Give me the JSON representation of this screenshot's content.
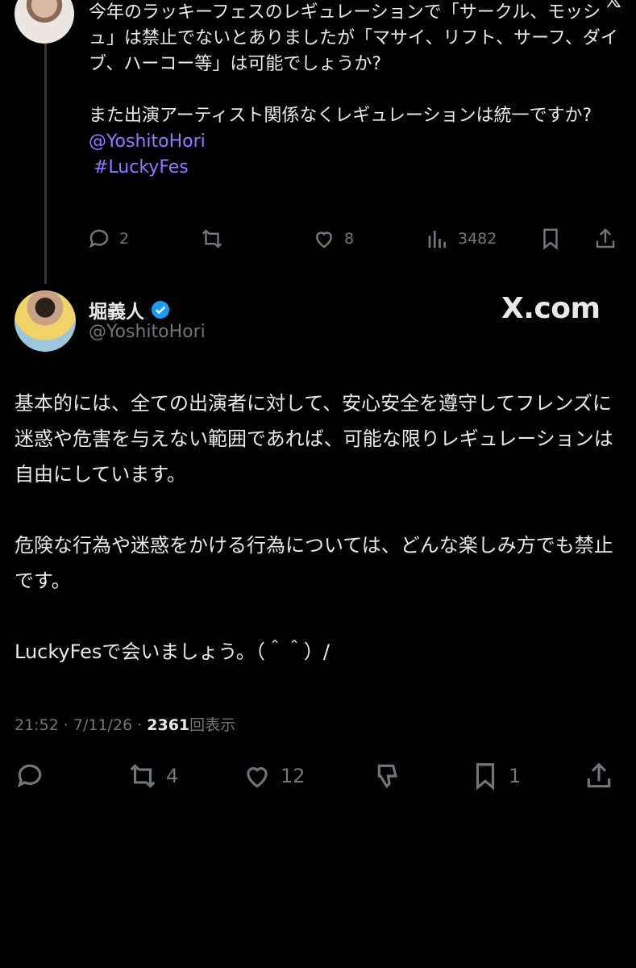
{
  "reply": {
    "paragraph1": "今年のラッキーフェスのレギュレーションで「サークル、モッシュ」は禁止でないとありましたが「マサイ、リフト、サーフ、ダイブ、ハーコー等」は可能でしょうか?",
    "paragraph2": "また出演アーティスト関係なくレギュレーションは統一ですか?",
    "mention": "@YoshitoHori",
    "hashtag": "#LuckyFes",
    "actions": {
      "replies": "2",
      "likes": "8",
      "views": "3482"
    }
  },
  "tweet": {
    "display_name": "堀義人",
    "handle": "@YoshitoHori",
    "paragraphs": [
      "基本的には、全ての出演者に対して、安心安全を遵守してフレンズに迷惑や危害を与えない範囲であれば、可能な限りレギュレーションは自由にしています。",
      "危険な行為や迷惑をかける行為については、どんな楽しみ方でも禁止です。",
      "LuckyFesで会いましょう。（＾＾）/"
    ],
    "time": "21:52 · 7/11/26 · ",
    "views_count": "2361",
    "views_label": "回表示",
    "actions": {
      "retweets": "4",
      "likes": "12",
      "bookmarks": "1"
    }
  },
  "watermark": "X.com",
  "colors": {
    "background": "#000000",
    "text": "#e7e9ea",
    "muted": "#71767b",
    "link": "#8e7cff",
    "verified": "#1d9bf0"
  },
  "icons": [
    "reply-icon",
    "retweet-icon",
    "like-icon",
    "views-icon",
    "bookmark-icon",
    "share-icon",
    "dislike-icon",
    "verified-badge-icon",
    "x-logo-icon"
  ]
}
